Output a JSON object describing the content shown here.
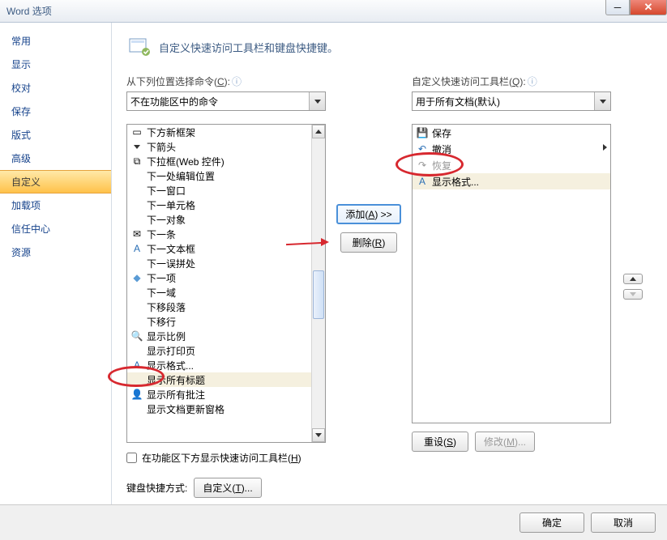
{
  "window": {
    "title": "Word 选项"
  },
  "sidebar": {
    "items": [
      {
        "label": "常用"
      },
      {
        "label": "显示"
      },
      {
        "label": "校对"
      },
      {
        "label": "保存"
      },
      {
        "label": "版式"
      },
      {
        "label": "高级"
      },
      {
        "label": "自定义"
      },
      {
        "label": "加载项"
      },
      {
        "label": "信任中心"
      },
      {
        "label": "资源"
      }
    ]
  },
  "header": {
    "text": "自定义快速访问工具栏和键盘快捷键。"
  },
  "left": {
    "label_prefix": "从下列位置选择命令(",
    "label_key": "C",
    "label_suffix": "):",
    "combo": "不在功能区中的命令",
    "items": [
      "下方新框架",
      "下箭头",
      "下拉框(Web 控件)",
      "下一处编辑位置",
      "下一窗口",
      "下一单元格",
      "下一对象",
      "下一条",
      "下一文本框",
      "下一误拼处",
      "下一项",
      "下一域",
      "下移段落",
      "下移行",
      "显示比例",
      "显示打印页",
      "显示格式...",
      "显示所有标题",
      "显示所有批注",
      "显示文档更新窗格"
    ]
  },
  "mid": {
    "add_prefix": "添加(",
    "add_key": "A",
    "add_suffix": ") >>",
    "remove_prefix": "删除(",
    "remove_key": "R",
    "remove_suffix": ")"
  },
  "right": {
    "label_prefix": "自定义快速访问工具栏(",
    "label_key": "Q",
    "label_suffix": "):",
    "combo": "用于所有文档(默认)",
    "items": [
      "保存",
      "撤消",
      "恢复",
      "显示格式..."
    ],
    "reset_prefix": "重设(",
    "reset_key": "S",
    "reset_suffix": ")",
    "modify_prefix": "修改(",
    "modify_key": "M",
    "modify_suffix": ")..."
  },
  "options": {
    "show_below_ribbon_prefix": "在功能区下方显示快速访问工具栏(",
    "show_below_ribbon_key": "H",
    "show_below_ribbon_suffix": ")",
    "keyboard_label": "键盘快捷方式:",
    "customize_btn_prefix": "自定义(",
    "customize_btn_key": "T",
    "customize_btn_suffix": ")..."
  },
  "footer": {
    "ok": "确定",
    "cancel": "取消"
  }
}
